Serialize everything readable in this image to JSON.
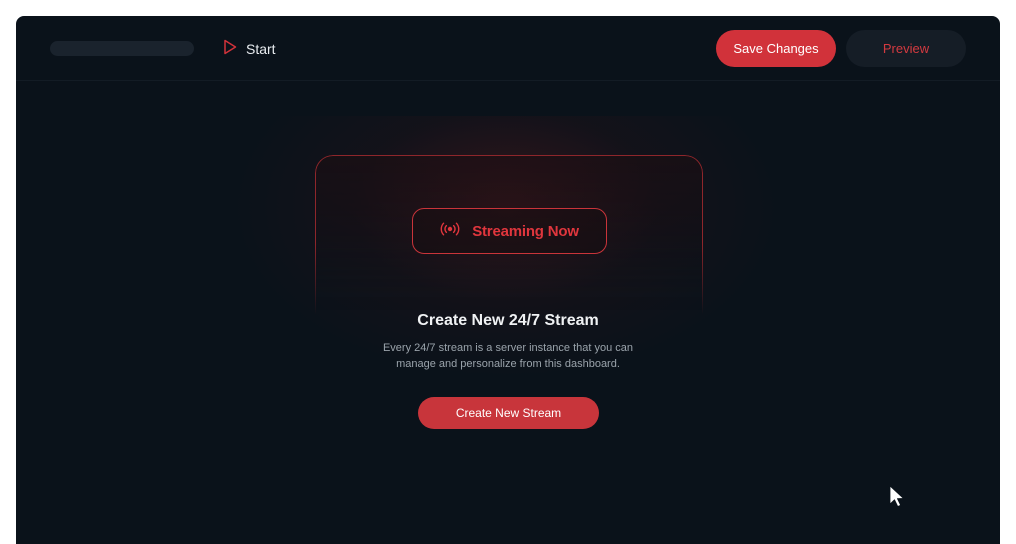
{
  "header": {
    "start_label": "Start",
    "save_label": "Save Changes",
    "preview_label": "Preview"
  },
  "card": {
    "badge_label": "Streaming Now",
    "title": "Create New 24/7 Stream",
    "description_line1": "Every 24/7 stream is a server instance that you can",
    "description_line2": "manage and personalize from this dashboard.",
    "create_label": "Create New Stream"
  },
  "icons": {
    "start": "play-outline-icon",
    "badge": "broadcast-icon",
    "cursor": "mouse-pointer-icon"
  },
  "colors": {
    "accent": "#d1323a",
    "background": "#0a121a",
    "surface": "#151d26"
  }
}
